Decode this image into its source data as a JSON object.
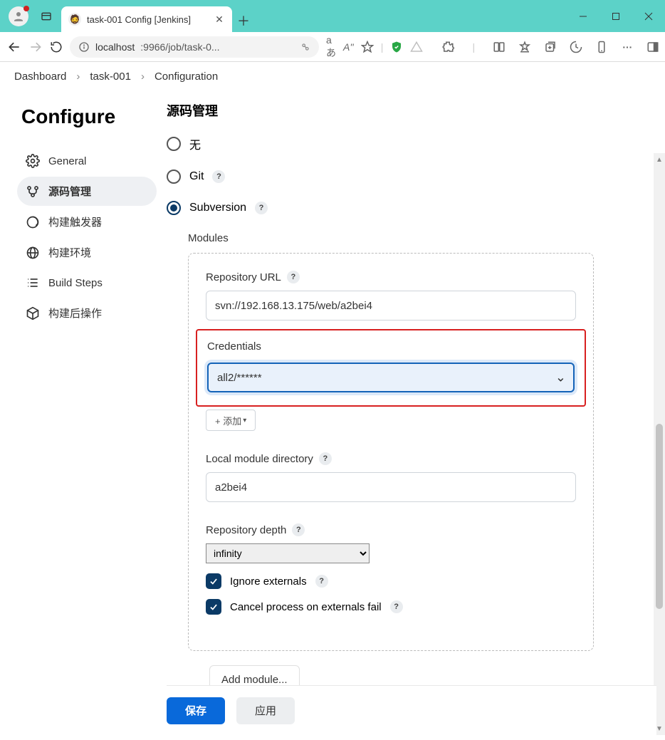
{
  "browser": {
    "tab_title": "task-001 Config [Jenkins]",
    "url_host": "localhost",
    "url_rest": ":9966/job/task-0...",
    "translate": "aあ",
    "text_size": "A''"
  },
  "breadcrumb": {
    "dashboard": "Dashboard",
    "job": "task-001",
    "page": "Configuration"
  },
  "sidebar": {
    "title": "Configure",
    "items": [
      {
        "label": "General"
      },
      {
        "label": "源码管理"
      },
      {
        "label": "构建触发器"
      },
      {
        "label": "构建环境"
      },
      {
        "label": "Build Steps"
      },
      {
        "label": "构建后操作"
      }
    ],
    "active_index": 1
  },
  "scm": {
    "heading": "源码管理",
    "options": {
      "none": "无",
      "git": "Git",
      "svn": "Subversion"
    },
    "modules_label": "Modules",
    "repo_url_label": "Repository URL",
    "repo_url_value": "svn://192.168.13.175/web/a2bei4",
    "cred_label": "Credentials",
    "cred_value": "all2/******",
    "add_label": "+ 添加",
    "local_dir_label": "Local module directory",
    "local_dir_value": "a2bei4",
    "depth_label": "Repository depth",
    "depth_value": "infinity",
    "ignore_ext_label": "Ignore externals",
    "cancel_ext_label": "Cancel process on externals fail",
    "add_module_label": "Add module..."
  },
  "footer": {
    "save": "保存",
    "apply": "应用"
  }
}
